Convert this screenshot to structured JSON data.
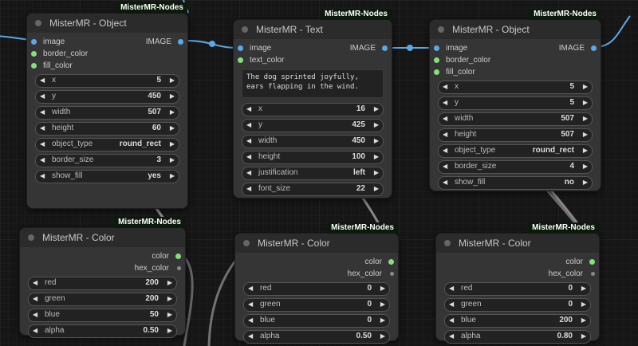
{
  "badge_label": "MisterMR-Nodes",
  "nodes": {
    "object1": {
      "title": "MisterMR - Object",
      "input_image": "image",
      "input_border_color": "border_color",
      "input_fill_color": "fill_color",
      "output_image": "IMAGE",
      "widgets": [
        {
          "name": "x",
          "value": "5"
        },
        {
          "name": "y",
          "value": "450"
        },
        {
          "name": "width",
          "value": "507"
        },
        {
          "name": "height",
          "value": "60"
        },
        {
          "name": "object_type",
          "value": "round_rect"
        },
        {
          "name": "border_size",
          "value": "3"
        },
        {
          "name": "show_fill",
          "value": "yes"
        }
      ]
    },
    "text1": {
      "title": "MisterMR - Text",
      "input_image": "image",
      "input_text_color": "text_color",
      "output_image": "IMAGE",
      "text": "The dog sprinted joyfully, ears flapping in the wind.",
      "widgets": [
        {
          "name": "x",
          "value": "16"
        },
        {
          "name": "y",
          "value": "425"
        },
        {
          "name": "width",
          "value": "450"
        },
        {
          "name": "height",
          "value": "100"
        },
        {
          "name": "justification",
          "value": "left"
        },
        {
          "name": "font_size",
          "value": "22"
        }
      ]
    },
    "object2": {
      "title": "MisterMR - Object",
      "input_image": "image",
      "input_border_color": "border_color",
      "input_fill_color": "fill_color",
      "output_image": "IMAGE",
      "widgets": [
        {
          "name": "x",
          "value": "5"
        },
        {
          "name": "y",
          "value": "5"
        },
        {
          "name": "width",
          "value": "507"
        },
        {
          "name": "height",
          "value": "507"
        },
        {
          "name": "object_type",
          "value": "round_rect"
        },
        {
          "name": "border_size",
          "value": "4"
        },
        {
          "name": "show_fill",
          "value": "no"
        }
      ]
    },
    "color1": {
      "title": "MisterMR - Color",
      "output_color": "color",
      "output_hex": "hex_color",
      "widgets": [
        {
          "name": "red",
          "value": "200"
        },
        {
          "name": "green",
          "value": "200"
        },
        {
          "name": "blue",
          "value": "50"
        },
        {
          "name": "alpha",
          "value": "0.50"
        }
      ]
    },
    "color2": {
      "title": "MisterMR - Color",
      "output_color": "color",
      "output_hex": "hex_color",
      "widgets": [
        {
          "name": "red",
          "value": "0"
        },
        {
          "name": "green",
          "value": "0"
        },
        {
          "name": "blue",
          "value": "0"
        },
        {
          "name": "alpha",
          "value": "0.50"
        }
      ]
    },
    "color3": {
      "title": "MisterMR - Color",
      "output_color": "color",
      "output_hex": "hex_color",
      "widgets": [
        {
          "name": "red",
          "value": "0"
        },
        {
          "name": "green",
          "value": "0"
        },
        {
          "name": "blue",
          "value": "200"
        },
        {
          "name": "alpha",
          "value": "0.80"
        }
      ]
    }
  },
  "colors": {
    "image_link": "#5aa9e6",
    "color_link": "#9a9a9a",
    "canvas": "#161616",
    "node_body": "#353535",
    "node_header": "#2b2b2b"
  }
}
